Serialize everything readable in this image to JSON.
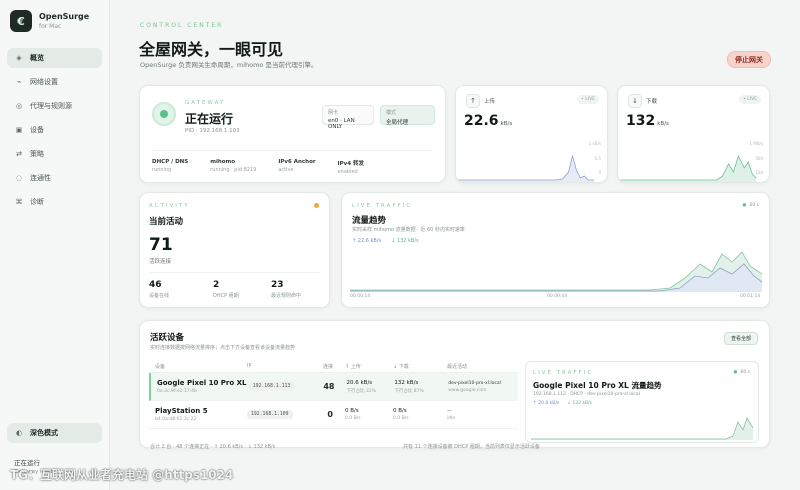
{
  "app": {
    "name": "OpenSurge",
    "subtitle": "for Mac",
    "logo_glyph": "€"
  },
  "nav": [
    {
      "label": "概览",
      "icon": "diamond-icon",
      "glyph": "◈",
      "active": true
    },
    {
      "label": "网络设置",
      "icon": "network-icon",
      "glyph": "⌁",
      "active": false
    },
    {
      "label": "代理与规则源",
      "icon": "rules-icon",
      "glyph": "◎",
      "active": false
    },
    {
      "label": "设备",
      "icon": "device-icon",
      "glyph": "▣",
      "active": false
    },
    {
      "label": "策略",
      "icon": "policy-icon",
      "glyph": "⇄",
      "active": false
    },
    {
      "label": "连通性",
      "icon": "connectivity-icon",
      "glyph": "◌",
      "active": false
    },
    {
      "label": "诊断",
      "icon": "diagnostics-icon",
      "glyph": "⌘",
      "active": false
    }
  ],
  "theme_toggle": {
    "label": "深色模式",
    "glyph": "◐"
  },
  "sidebar_status": {
    "label": "正在运行",
    "sub": "Gateway ready"
  },
  "header": {
    "eyebrow": "CONTROL CENTER",
    "title": "全屋网关，一眼可见",
    "subtitle": "OpenSurge 负责网关生命周期，mihomo 是当前代理引擎。",
    "stop_button": "停止网关"
  },
  "gateway": {
    "eyebrow": "GATEWAY",
    "status": "正在运行",
    "pid": "PID · 192.168.1.103",
    "box1": {
      "title": "网卡",
      "value": "en0 · LAN ONLY"
    },
    "box2": {
      "title": "模式",
      "value": "全局代理"
    },
    "stats": [
      {
        "title": "DHCP / DNS",
        "value": "running"
      },
      {
        "title": "mihomo",
        "value": "running · pid 8219"
      },
      {
        "title": "IPv6 Anchor",
        "value": "active"
      },
      {
        "title": "IPv4 转发",
        "value": "enabled"
      }
    ]
  },
  "upload": {
    "label": "上传",
    "chip": "• LIVE",
    "value": "22.6",
    "unit": "kB/s",
    "glyph": "↑",
    "side": [
      "1 kB/s",
      "0.5",
      "0"
    ]
  },
  "download": {
    "label": "下载",
    "chip": "• LIVE",
    "value": "132",
    "unit": "kB/s",
    "glyph": "↓",
    "side": [
      "1 MB/s",
      "500",
      "100"
    ]
  },
  "activity": {
    "eyebrow": "ACTIVITY",
    "title": "当前活动",
    "count": "71",
    "count_label": "活跃连接",
    "minis": [
      {
        "num": "46",
        "label": "设备在线"
      },
      {
        "num": "2",
        "label": "DHCP 租期"
      },
      {
        "num": "23",
        "label": "最近规则命中"
      }
    ]
  },
  "live": {
    "eyebrow": "LIVE TRAFFIC",
    "title": "流量趋势",
    "sub": "实时采样 mihomo 流量数据 · 近 60 秒内实时速率",
    "legend_up": "↑ 22.6 kB/s",
    "legend_down": "↓ 132 kB/s",
    "window": "60 s",
    "t_start": "00:00:14",
    "t_mid": "00:00:44",
    "t_end": "00:01:14"
  },
  "devices": {
    "title": "活跃设备",
    "sub": "实时连接数据按网络流量排序；点击下方设备查看该设备流量趋势",
    "button": "查看全部",
    "columns": [
      "设备",
      "IP",
      "连接",
      "↑ 上传",
      "↓ 下载",
      "最近活动"
    ],
    "rows": [
      {
        "name": "Google Pixel 10 Pro XL",
        "mac": "0a:3c:9f:e2:17:4b",
        "ip": "192.168.1.113",
        "conn": "48",
        "up": "20.6 kB/s",
        "up_sub": "下行占比 32%",
        "down": "132 kB/s",
        "down_sub": "下行占比 87%",
        "act1": "dev-pixel10-pro-xl.local",
        "act2": "www.google.com",
        "selected": true
      },
      {
        "name": "PlayStation 5",
        "mac": "b4:0a:d8:61:3c:22",
        "ip": "192.168.1.109",
        "conn": "0",
        "up": "0 B/s",
        "up_sub": "0.0 B/s",
        "down": "0 B/s",
        "down_sub": "0.0 B/s",
        "act1": "—",
        "act2": "idle",
        "selected": false
      }
    ],
    "footer_left": "合计 2 台 · 48 个连接正在 · ↑ 20.6 kB/s · ↓ 132 kB/s",
    "footer_right": "共有 11 个连接设备被 DHCP 租期，当前列表仅显示活跃设备"
  },
  "device_traffic": {
    "eyebrow": "LIVE TRAFFIC",
    "title": "Google Pixel 10 Pro XL 流量趋势",
    "sub": "192.168.1.113 · DHCP · dev-pixel10-pro-xl.local",
    "legend_up": "↑ 20.6 kB/s",
    "legend_down": "↓ 132 kB/s",
    "window": "60 s"
  },
  "watermark": "TG：互联网从业者充电站 @https1024"
}
